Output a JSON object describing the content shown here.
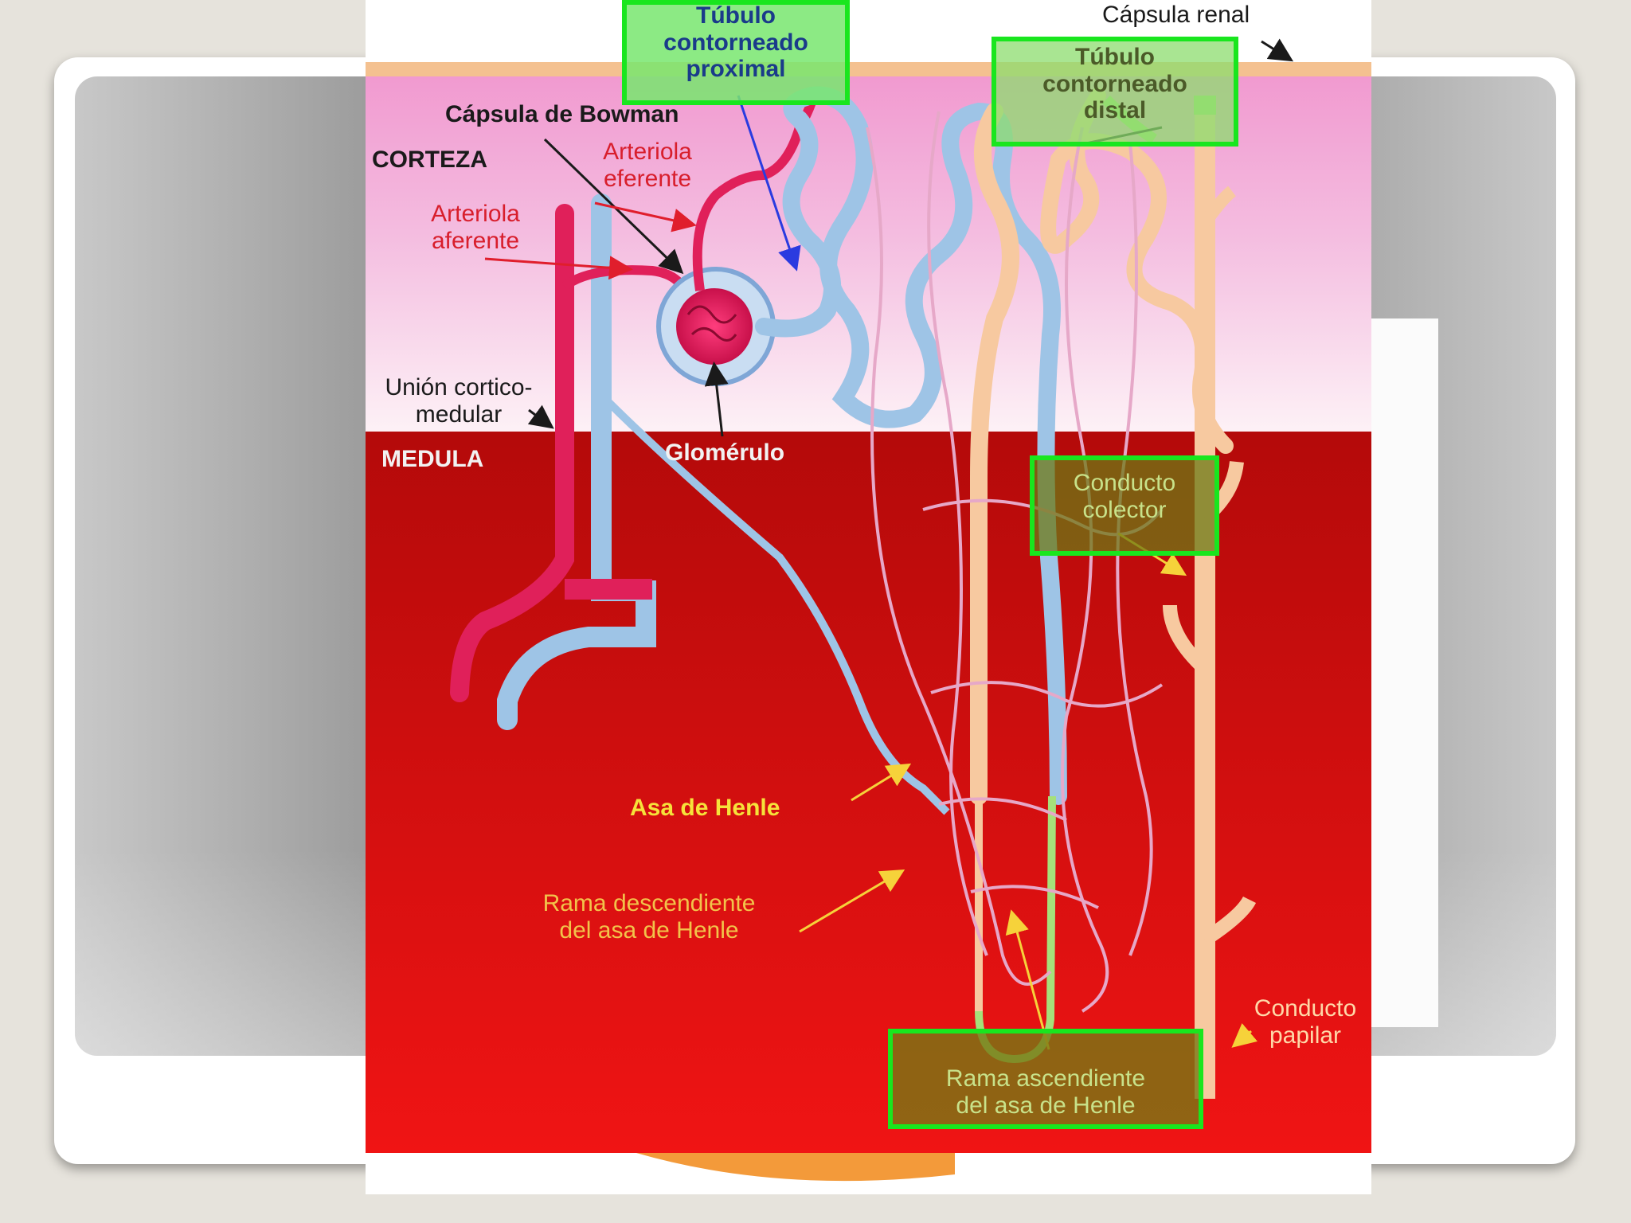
{
  "diagram": {
    "labels": {
      "capsula_renal": "Cápsula renal",
      "tubulo_proximal": "Túbulo\ncontorneado\nproximal",
      "tubulo_distal": "Túbulo\ncontorneado\ndistal",
      "capsula_bowman": "Cápsula de Bowman",
      "corteza": "CORTEZA",
      "arteriola_eferente": "Arteriola\neferente",
      "arteriola_aferente": "Arteriola\naferente",
      "union_corticomedular": "Unión cortico-\nmedular",
      "medula": "MEDULA",
      "glomerulo": "Glomérulo",
      "conducto_colector": "Conducto\ncolector",
      "asa_henle": "Asa de Henle",
      "rama_descendiente": "Rama descendiente\ndel asa de Henle",
      "conducto_papilar": "Conducto\npapilar",
      "rama_ascendiente": "Rama ascendiente\ndel asa de Henle"
    },
    "colors": {
      "cortex_pink": "#f0a8d0",
      "medulla_red": "#c81010",
      "artery": "#e0205a",
      "vein": "#9ec4e6",
      "collecting_duct": "#f7c9a0",
      "capillary": "#e6a8c8",
      "highlight": "#19e61e"
    }
  }
}
